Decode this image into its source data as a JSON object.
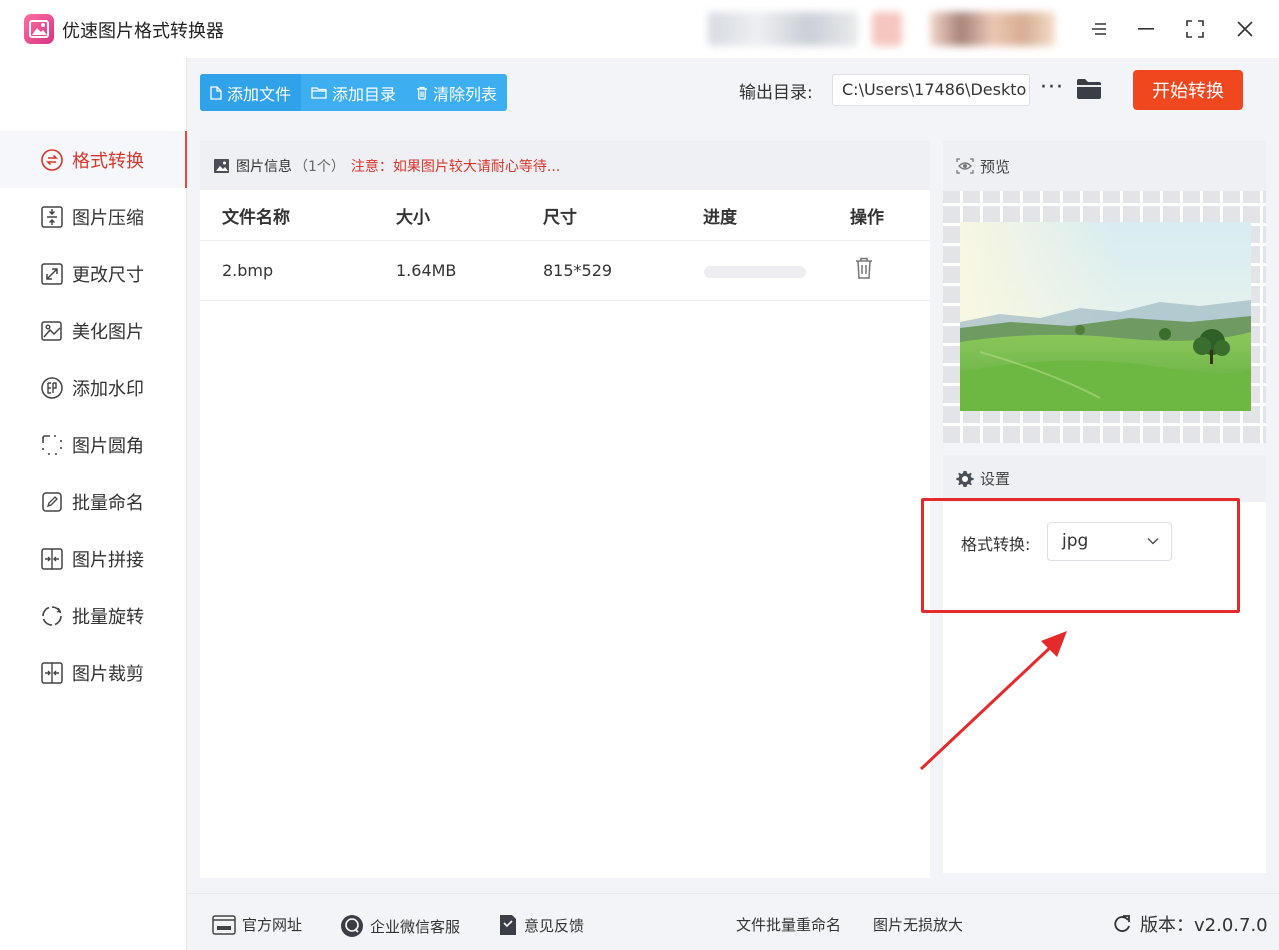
{
  "app": {
    "title": "优速图片格式转换器"
  },
  "window_controls": {
    "menu_icon": "menu-icon",
    "minimize_icon": "minimize-icon",
    "maximize_icon": "maximize-icon",
    "close_icon": "close-icon"
  },
  "sidebar": {
    "items": [
      {
        "label": "格式转换",
        "icon": "format-convert-icon",
        "active": true
      },
      {
        "label": "图片压缩",
        "icon": "compress-icon",
        "active": false
      },
      {
        "label": "更改尺寸",
        "icon": "resize-icon",
        "active": false
      },
      {
        "label": "美化图片",
        "icon": "beautify-icon",
        "active": false
      },
      {
        "label": "添加水印",
        "icon": "watermark-icon",
        "active": false
      },
      {
        "label": "图片圆角",
        "icon": "rounded-corner-icon",
        "active": false
      },
      {
        "label": "批量命名",
        "icon": "batch-rename-icon",
        "active": false
      },
      {
        "label": "图片拼接",
        "icon": "stitch-icon",
        "active": false
      },
      {
        "label": "批量旋转",
        "icon": "rotate-icon",
        "active": false
      },
      {
        "label": "图片裁剪",
        "icon": "crop-icon",
        "active": false
      }
    ]
  },
  "toolbar": {
    "add_file": "添加文件",
    "add_folder": "添加目录",
    "clear_list": "清除列表",
    "output_label": "输出目录:",
    "output_path": "C:\\Users\\17486\\Deskto",
    "more": "···",
    "start": "开始转换"
  },
  "file_panel": {
    "title": "图片信息",
    "count": "（1个）",
    "notice": "注意：如果图片较大请耐心等待...",
    "columns": [
      "文件名称",
      "大小",
      "尺寸",
      "进度",
      "操作"
    ],
    "rows": [
      {
        "name": "2.bmp",
        "size": "1.64MB",
        "dimensions": "815*529",
        "progress": 0
      }
    ]
  },
  "preview": {
    "title": "预览"
  },
  "settings": {
    "title": "设置",
    "format_label": "格式转换:",
    "format_value": "jpg"
  },
  "footer": {
    "website": "官方网址",
    "wechat": "企业微信客服",
    "feedback": "意见反馈",
    "batch_rename": "文件批量重命名",
    "upscale": "图片无损放大",
    "version": "版本：v2.0.7.0"
  },
  "colors": {
    "accent_blue": "#3daeef",
    "start_orange": "#f1471f",
    "active_red": "#d9362b",
    "highlight_red": "#e42a2a"
  }
}
